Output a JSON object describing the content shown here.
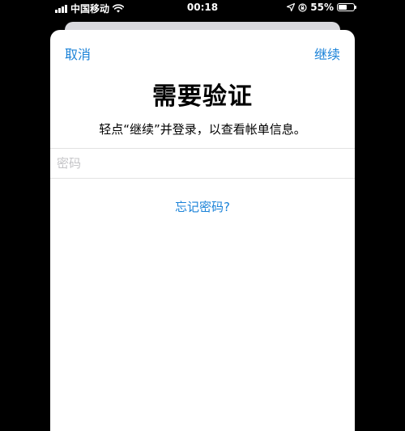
{
  "status_bar": {
    "carrier": "中国移动",
    "time": "00:18",
    "battery_percent_label": "55%",
    "battery_level": 0.55,
    "icons": [
      "signal-bars-icon",
      "wifi-icon",
      "location-arrow-icon",
      "orientation-lock-icon",
      "battery-icon"
    ]
  },
  "nav": {
    "cancel_label": "取消",
    "continue_label": "继续"
  },
  "dialog": {
    "title": "需要验证",
    "subtitle": "轻点“继续”并登录，以查看帐单信息。"
  },
  "password_field": {
    "placeholder": "密码",
    "value": ""
  },
  "forgot_link": "忘记密码?",
  "colors": {
    "accent": "#1a82d8",
    "background_outer": "#000000",
    "sheet": "#ffffff",
    "back_card": "#d9d9de",
    "separator": "#e2e2e2",
    "placeholder": "#c4c4c7"
  }
}
